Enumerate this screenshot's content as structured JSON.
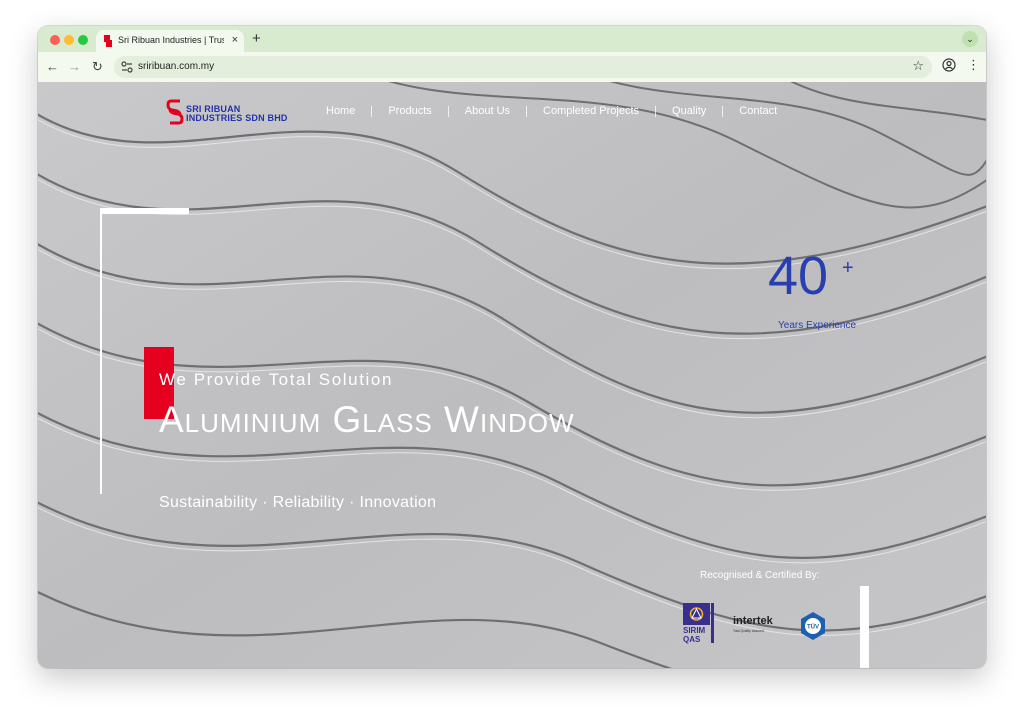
{
  "browser": {
    "tab": {
      "title": "Sri Ribuan Industries | Trusted"
    },
    "new_tab": "+",
    "tab_close": "×",
    "tab_menu": "⌄",
    "nav": {
      "back": "←",
      "forward": "→",
      "reload": "↻"
    },
    "address": {
      "url": "sriribuan.com.my"
    },
    "bookmark": "☆",
    "menu": "⋮"
  },
  "site": {
    "logo": {
      "line1": "SRI RIBUAN",
      "line2": "INDUSTRIES SDN BHD"
    },
    "nav": {
      "home": "Home",
      "products": "Products",
      "about": "About Us",
      "projects": "Completed Projects",
      "quality": "Quality",
      "contact": "Contact"
    },
    "hero": {
      "tagline": "We Provide Total Solution",
      "headline": "Aluminium Glass Window",
      "subline": "Sustainability · Reliability · Innovation"
    },
    "stat": {
      "number": "40",
      "suffix": "+",
      "label": "Years Experience"
    },
    "certs": {
      "label": "Recognised & Certified By:",
      "sirim_line1": "SIRIM",
      "sirim_line2": "QAS",
      "intertek": "intertek",
      "intertek_tag": "Total Quality. Assured.",
      "tuv": "TÜV"
    }
  },
  "colors": {
    "accent_red": "#e6001f",
    "brand_blue": "#2a3fae",
    "browser_green": "#d8ebcf"
  }
}
